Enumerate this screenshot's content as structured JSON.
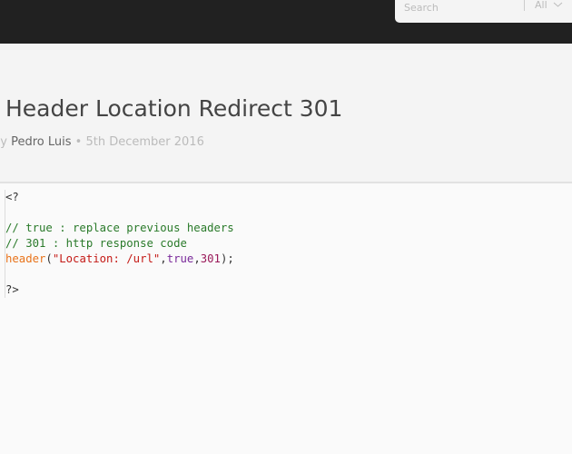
{
  "search": {
    "placeholder": "Search",
    "filter": "All"
  },
  "post": {
    "title": "Header Location Redirect 301",
    "by": "by",
    "author": "Pedro Luis",
    "separator": "•",
    "date": "5th December 2016"
  },
  "code": {
    "open": "<?",
    "comment1": "// true : replace previous headers",
    "comment2": "// 301 : http response code",
    "func": "header",
    "paren_open": "(",
    "string": "\"Location: /url\"",
    "comma1": ",",
    "bool": "true",
    "comma2": ",",
    "number": "301",
    "end": ");",
    "close": "?>"
  }
}
